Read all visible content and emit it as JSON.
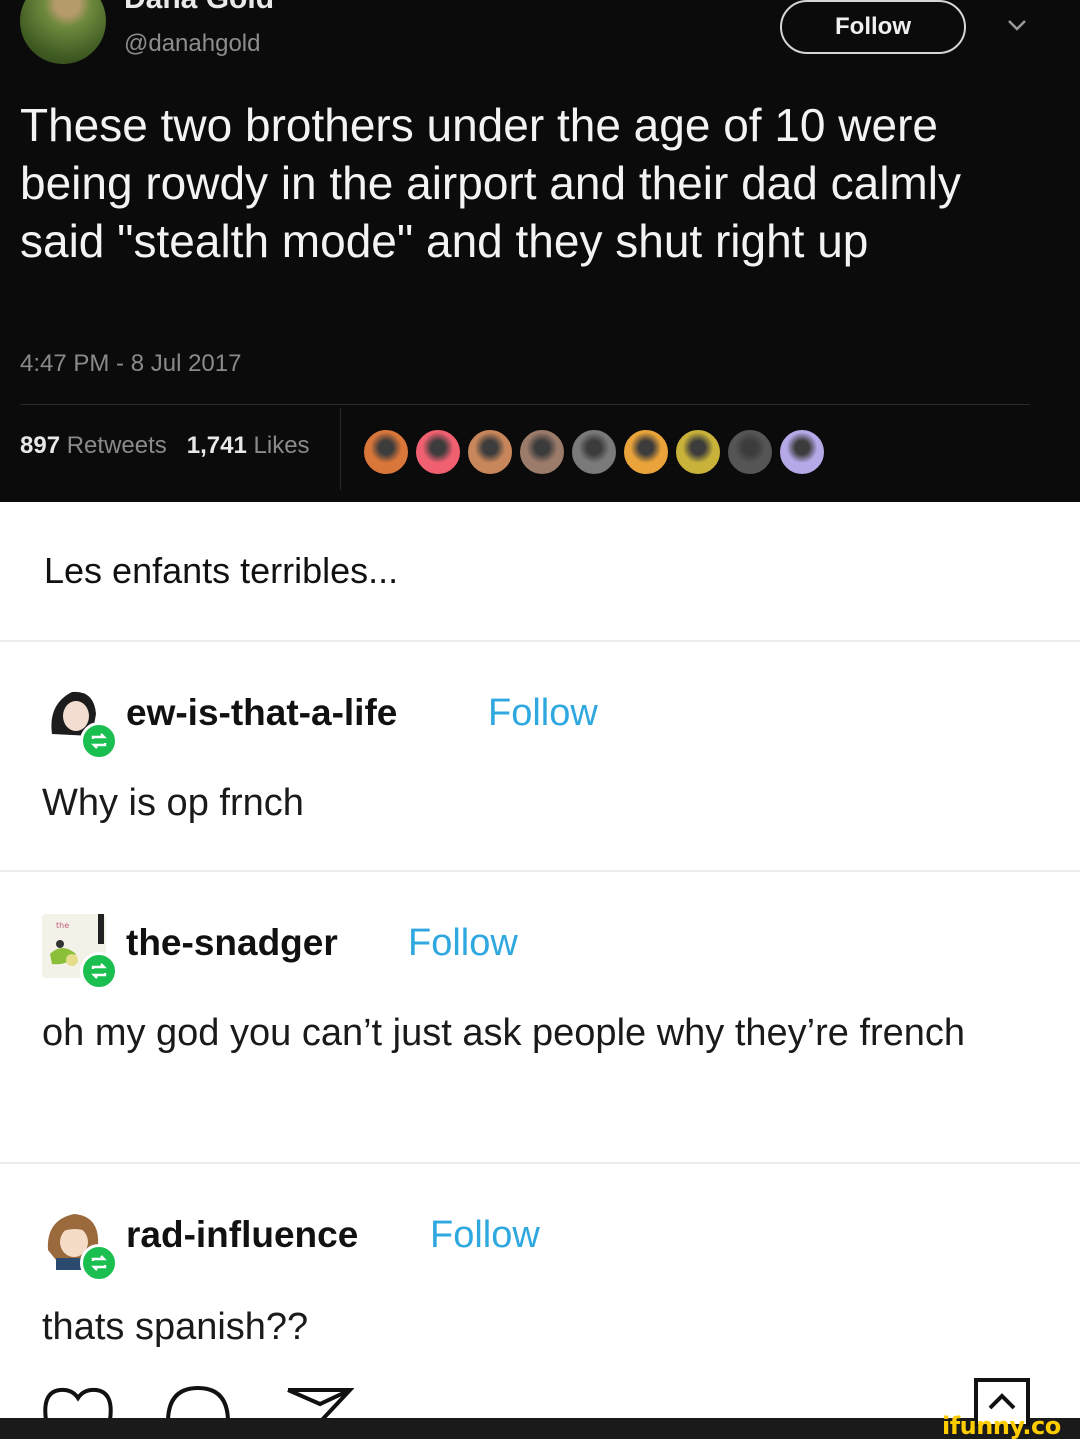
{
  "tweet": {
    "name": "Dana Gold",
    "handle": "@danahgold",
    "follow_label": "Follow",
    "text": "These two brothers under the age of 10 were being rowdy in the airport and their dad calmly said \"stealth mode\" and they shut right up",
    "timestamp": "4:47 PM - 8 Jul 2017",
    "retweets_count": "897",
    "retweets_label": "Retweets",
    "likes_count": "1,741",
    "likes_label": "Likes",
    "liker_colors": [
      "#d9763a",
      "#f06070",
      "#c8875a",
      "#9b7b6a",
      "#7a7a7a",
      "#e9a33a",
      "#c9b23a",
      "#555555",
      "#b7a9e8"
    ]
  },
  "caption": "Les enfants terribles...",
  "reblogs": [
    {
      "username": "ew-is-that-a-life",
      "follow_label": "Follow",
      "body": "Why is op frnch"
    },
    {
      "username": "the-snadger",
      "follow_label": "Follow",
      "body": "oh my god you can’t just ask people why they’re french"
    },
    {
      "username": "rad-influence",
      "follow_label": "Follow",
      "body": "thats spanish??"
    }
  ],
  "watermark": "ifunny.co",
  "colors": {
    "follow_blue": "#2fa8e0",
    "reblog_green": "#1bbf4f",
    "tweet_bg": "#0b0b0b"
  }
}
